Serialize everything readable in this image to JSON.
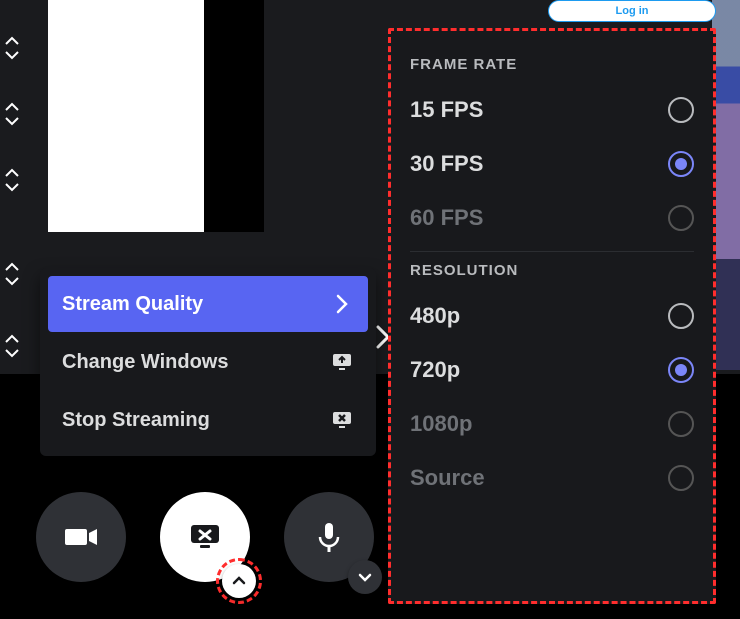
{
  "login_text": "Log in",
  "context_menu": {
    "stream_quality": "Stream Quality",
    "change_windows": "Change Windows",
    "stop_streaming": "Stop Streaming"
  },
  "quality_panel": {
    "frame_rate_title": "FRAME RATE",
    "frame_rate": {
      "fps15": "15 FPS",
      "fps30": "30 FPS",
      "fps60": "60 FPS"
    },
    "resolution_title": "RESOLUTION",
    "resolution": {
      "r480": "480p",
      "r720": "720p",
      "r1080": "1080p",
      "source": "Source"
    },
    "selected_fps": "30 FPS",
    "selected_resolution": "720p"
  }
}
